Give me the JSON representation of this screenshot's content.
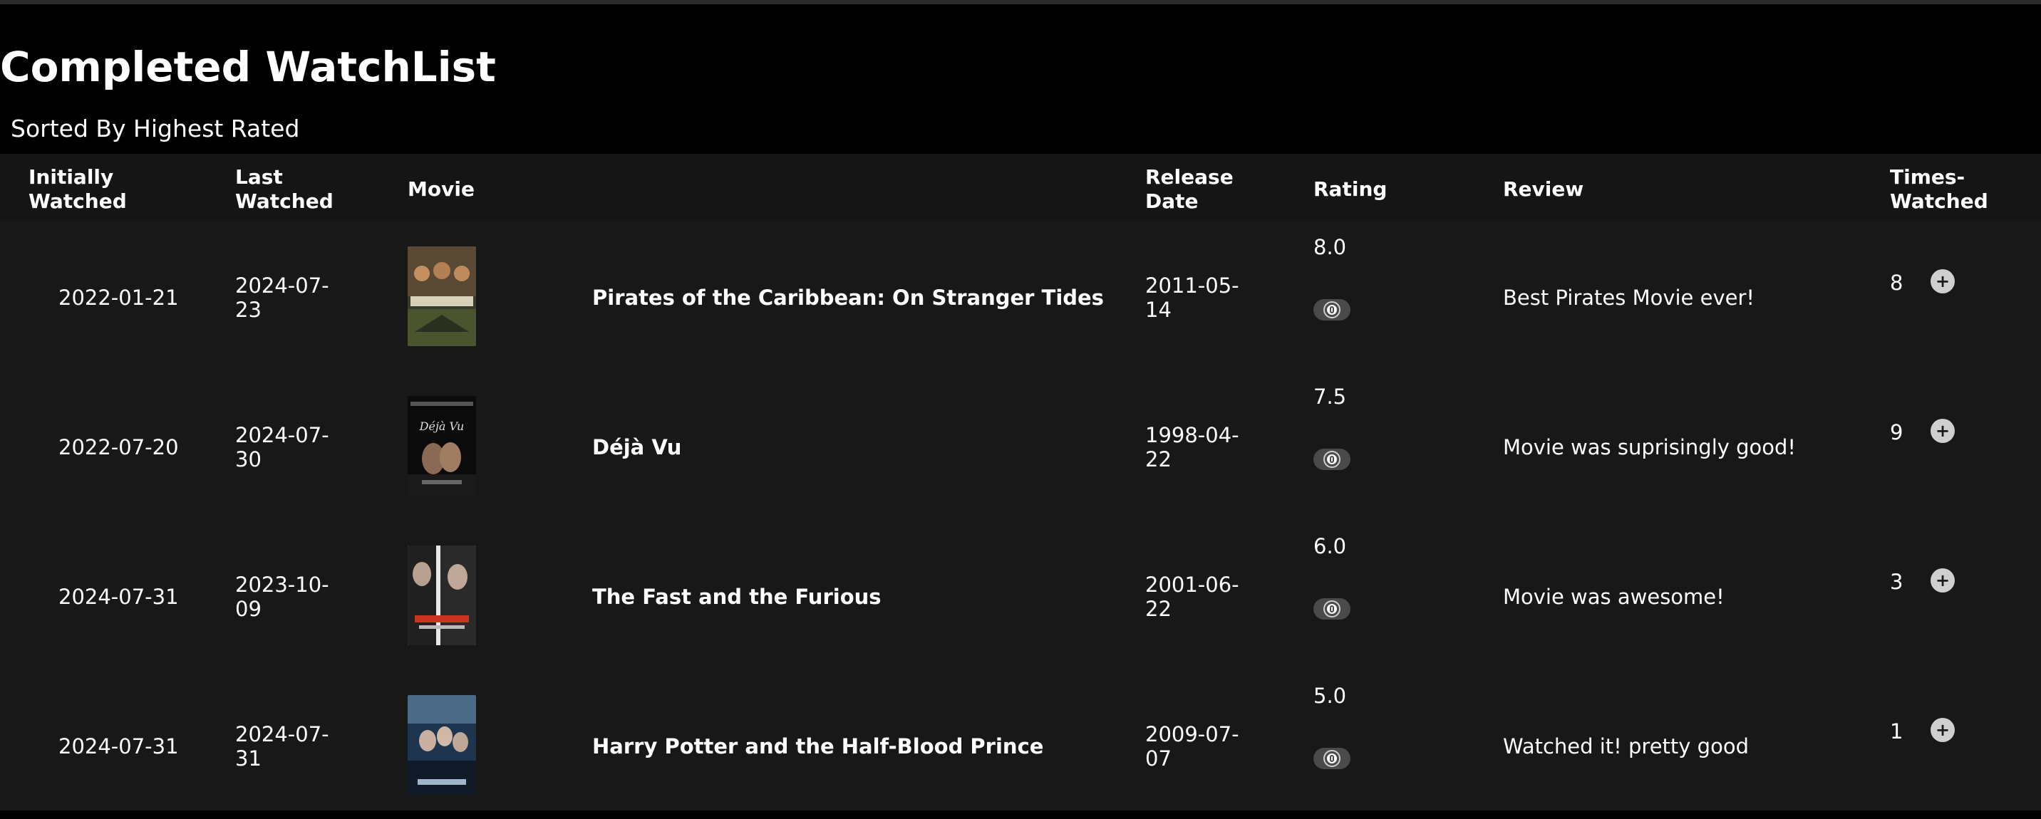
{
  "header": {
    "title": "Completed WatchList",
    "subtitle": "Sorted By Highest Rated"
  },
  "columns": {
    "initially_watched": [
      "Initially",
      "Watched"
    ],
    "last_watched": [
      "Last",
      "Watched"
    ],
    "movie": "Movie",
    "release_date": [
      "Release",
      "Date"
    ],
    "rating": "Rating",
    "review": "Review",
    "times_watched": [
      "Times-",
      "Watched"
    ]
  },
  "rows": [
    {
      "initially_watched": "2022-01-21",
      "last_watched": [
        "2024-07-",
        "23"
      ],
      "poster": "pirates-poster",
      "title": "Pirates of the Caribbean: On Stranger Tides",
      "release_date": [
        "2011-05-",
        "14"
      ],
      "rating": "8.0",
      "review": "Best Pirates Movie ever!",
      "times_watched": "8"
    },
    {
      "initially_watched": "2022-07-20",
      "last_watched": [
        "2024-07-",
        "30"
      ],
      "poster": "deja-vu-poster",
      "title": "Déjà Vu",
      "release_date": [
        "1998-04-",
        "22"
      ],
      "rating": "7.5",
      "review": "Movie was suprisingly good!",
      "times_watched": "9"
    },
    {
      "initially_watched": "2024-07-31",
      "last_watched": [
        "2023-10-",
        "09"
      ],
      "poster": "fast-furious-poster",
      "title": "The Fast and the Furious",
      "release_date": [
        "2001-06-",
        "22"
      ],
      "rating": "6.0",
      "review": "Movie was awesome!",
      "times_watched": "3"
    },
    {
      "initially_watched": "2024-07-31",
      "last_watched": [
        "2024-07-",
        "31"
      ],
      "poster": "harry-potter-poster",
      "title": "Harry Potter and the Half-Blood Prince",
      "release_date": [
        "2009-07-",
        "07"
      ],
      "rating": "5.0",
      "review": "Watched it! pretty good",
      "times_watched": "1"
    }
  ],
  "buttons": {
    "rating_toggle_icon": "toggle-icon",
    "increment_label": "+"
  }
}
